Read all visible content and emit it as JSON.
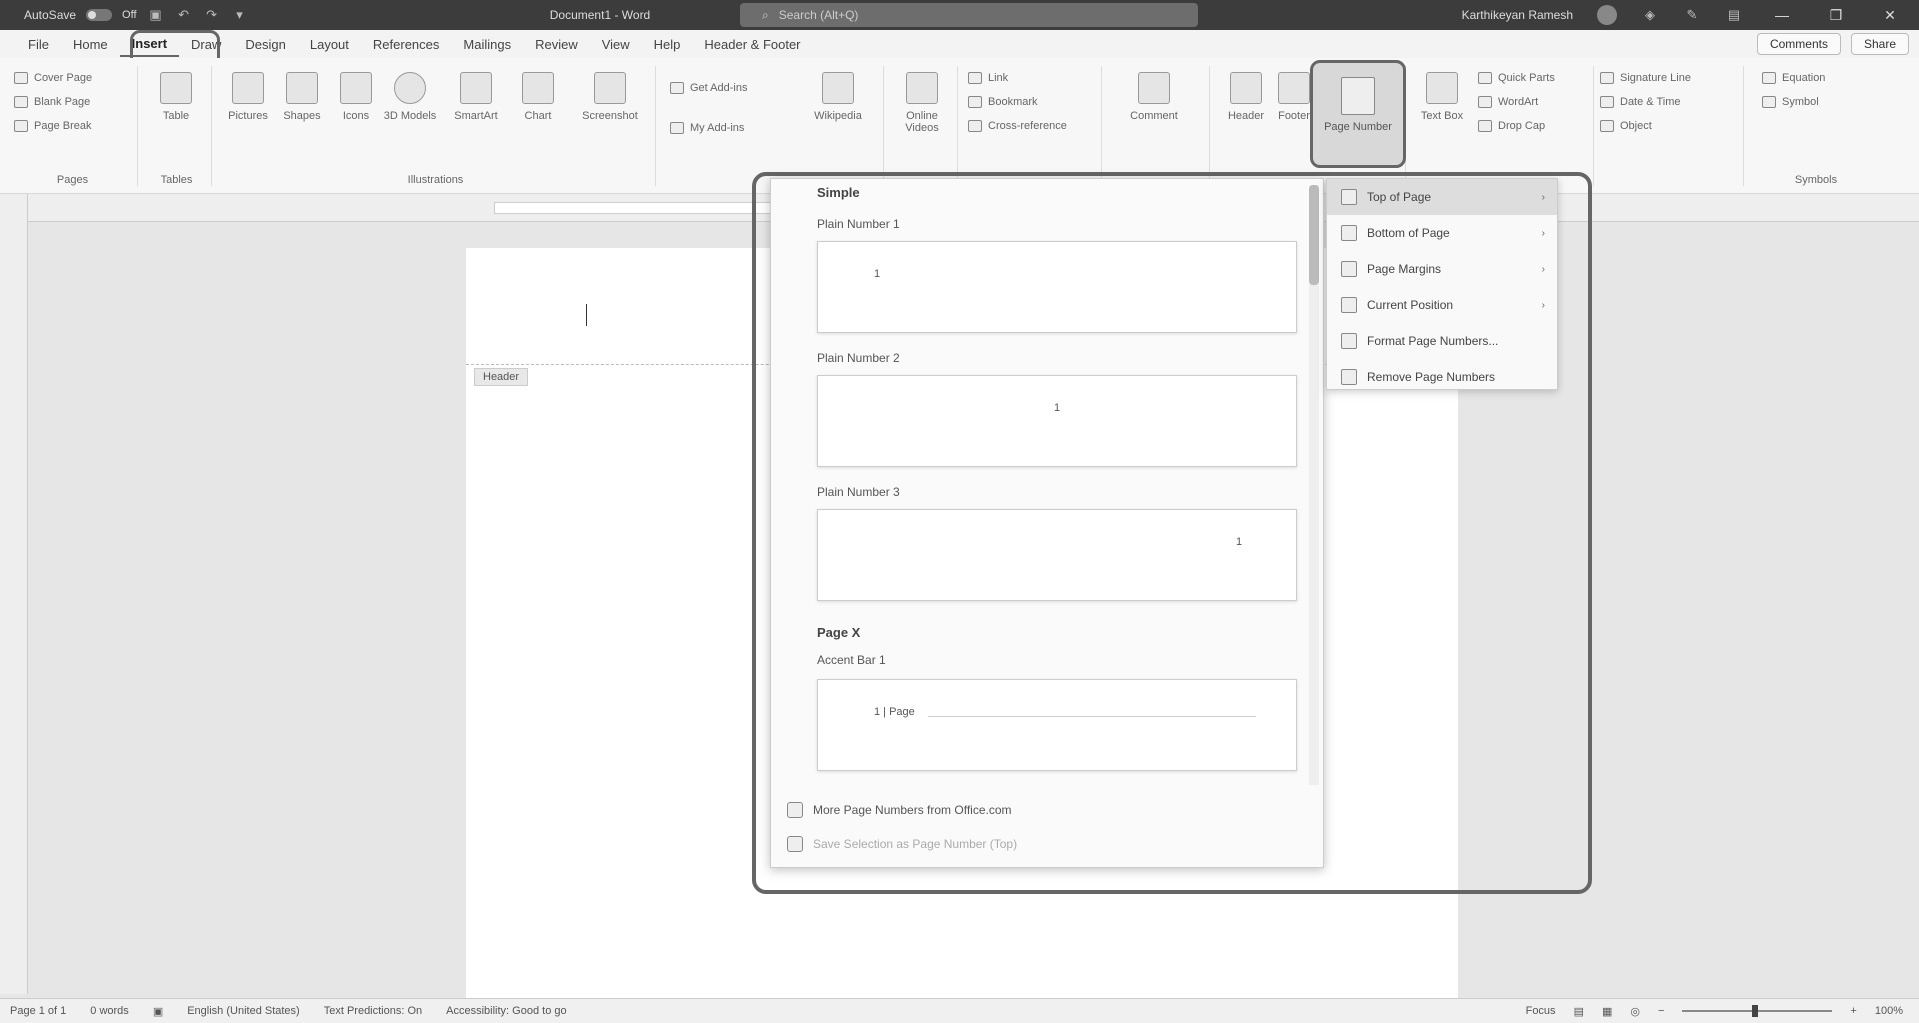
{
  "titlebar": {
    "autosave": "AutoSave",
    "autosave_state": "Off",
    "doc_title": "Document1 - Word",
    "search_placeholder": "Search (Alt+Q)",
    "user": "Karthikeyan Ramesh",
    "minimize": "—",
    "restore": "❐",
    "close": "✕"
  },
  "tabs": [
    "File",
    "Home",
    "Insert",
    "Draw",
    "Design",
    "Layout",
    "References",
    "Mailings",
    "Review",
    "View",
    "Help",
    "Header & Footer"
  ],
  "tab_actions": {
    "comments": "Comments",
    "share": "Share"
  },
  "ribbon": {
    "pages": {
      "label": "Pages",
      "items": [
        "Cover Page",
        "Blank Page",
        "Page Break"
      ]
    },
    "tables": {
      "label": "Tables",
      "table": "Table"
    },
    "illustrations": {
      "label": "Illustrations",
      "items": [
        "Pictures",
        "Shapes",
        "Icons",
        "3D Models",
        "SmartArt",
        "Chart",
        "Screenshot"
      ]
    },
    "addins": {
      "get": "Get Add-ins",
      "my": "My Add-ins",
      "wiki": "Wikipedia"
    },
    "media": {
      "online_video": "Online Videos"
    },
    "links": {
      "items": [
        "Link",
        "Bookmark",
        "Cross-reference"
      ]
    },
    "comments": {
      "comment": "Comment"
    },
    "header_footer": {
      "header": "Header",
      "footer": "Footer",
      "page_number": "Page Number"
    },
    "text": {
      "textbox": "Text Box",
      "items": [
        "Quick Parts",
        "WordArt",
        "Drop Cap"
      ]
    },
    "text2": {
      "items": [
        "Signature Line",
        "Date & Time",
        "Object"
      ]
    },
    "symbols": {
      "label": "Symbols",
      "items": [
        "Equation",
        "Symbol"
      ]
    }
  },
  "document": {
    "header_tag": "Header"
  },
  "gallery": {
    "section_simple": "Simple",
    "items": [
      {
        "label": "Plain Number 1",
        "num": "1",
        "align": "left"
      },
      {
        "label": "Plain Number 2",
        "num": "1",
        "align": "center"
      },
      {
        "label": "Plain Number 3",
        "num": "1",
        "align": "right"
      }
    ],
    "section_pagex": "Page X",
    "accent": {
      "label": "Accent Bar 1",
      "num": "1 | Page"
    },
    "footer1": "More Page Numbers from Office.com",
    "footer2": "Save Selection as Page Number (Top)"
  },
  "submenu": {
    "items": [
      {
        "label": "Top of Page",
        "arrow": "›"
      },
      {
        "label": "Bottom of Page",
        "arrow": "›"
      },
      {
        "label": "Page Margins",
        "arrow": "›"
      },
      {
        "label": "Current Position",
        "arrow": "›"
      },
      {
        "label": "Format Page Numbers...",
        "arrow": ""
      },
      {
        "label": "Remove Page Numbers",
        "arrow": ""
      }
    ]
  },
  "statusbar": {
    "page": "Page 1 of 1",
    "words": "0 words",
    "lang": "English (United States)",
    "text_predictions": "Text Predictions: On",
    "accessibility": "Accessibility: Good to go",
    "focus": "Focus",
    "zoom": "100%"
  }
}
